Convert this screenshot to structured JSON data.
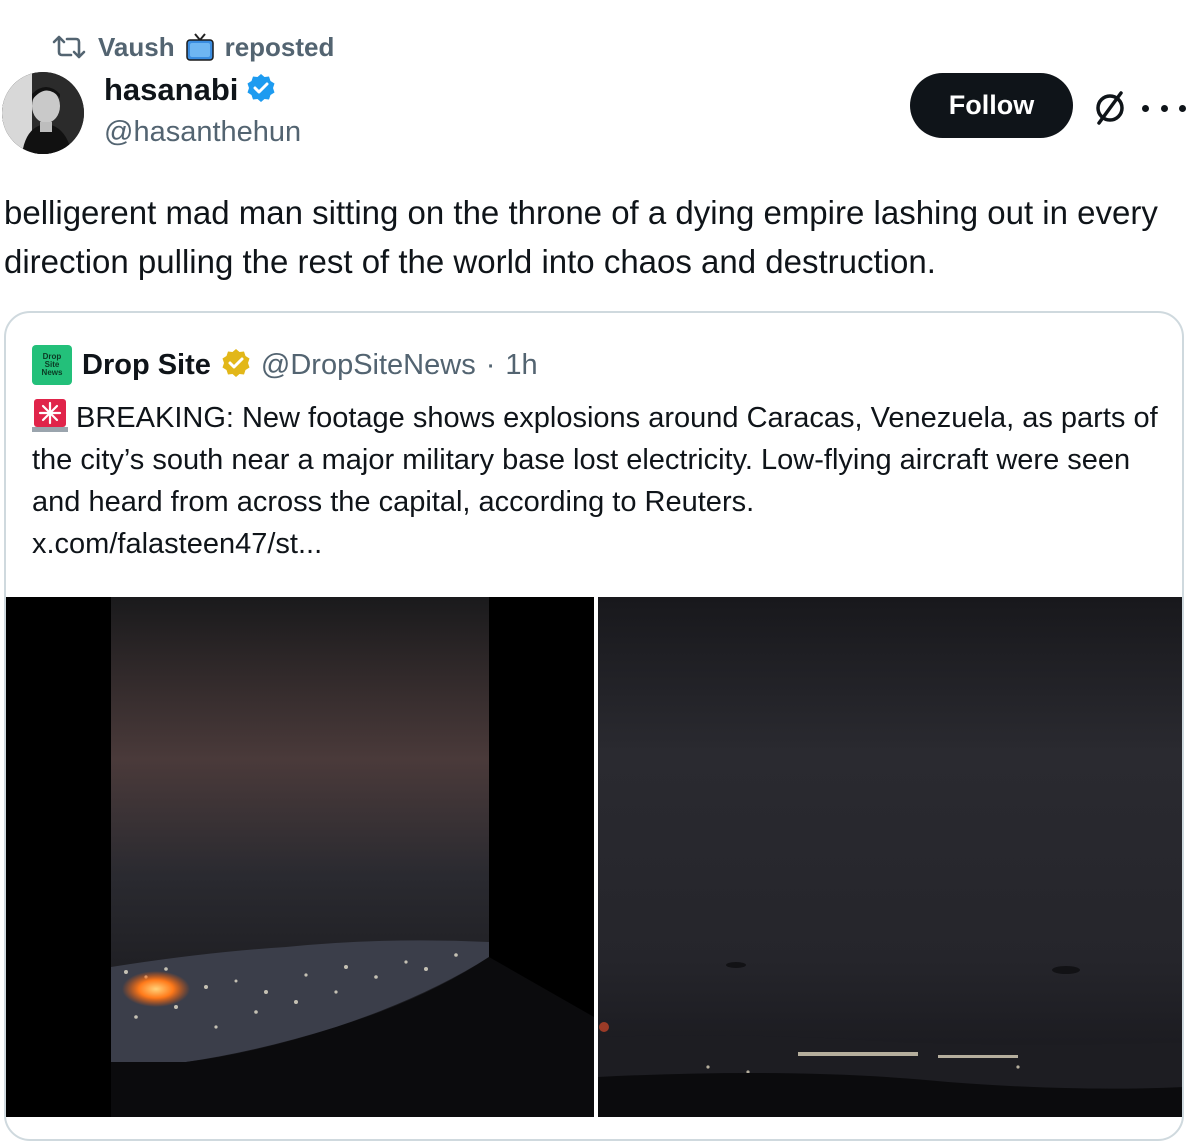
{
  "repost": {
    "user": "Vaush",
    "label": "reposted",
    "icon": "repost-icon",
    "emoji": "tv-icon"
  },
  "author": {
    "name": "hasanabi",
    "handle": "@hasanthehun",
    "verified_color": "#1d9bf0"
  },
  "actions": {
    "follow_label": "Follow"
  },
  "tweet": {
    "text": "belligerent mad man sitting on the throne of a dying empire lashing out in every direction pulling the rest of the world into chaos and destruction."
  },
  "quote": {
    "avatar_text": [
      "Drop",
      "Site",
      "News"
    ],
    "name": "Drop Site",
    "handle": "@DropSiteNews",
    "separator": "·",
    "time": "1h",
    "badge_color": "#e2b719",
    "text": "BREAKING: New footage shows explosions around Caracas, Venezuela, as parts of the city’s south near a major military base lost electricity. Low-flying aircraft were seen and heard from across the capital, according to Reuters.",
    "link": "x.com/falasteen47/st..."
  },
  "colors": {
    "text": "#0f1419",
    "secondary": "#536471",
    "border": "#cfd9de",
    "accent": "#1d9bf0"
  }
}
